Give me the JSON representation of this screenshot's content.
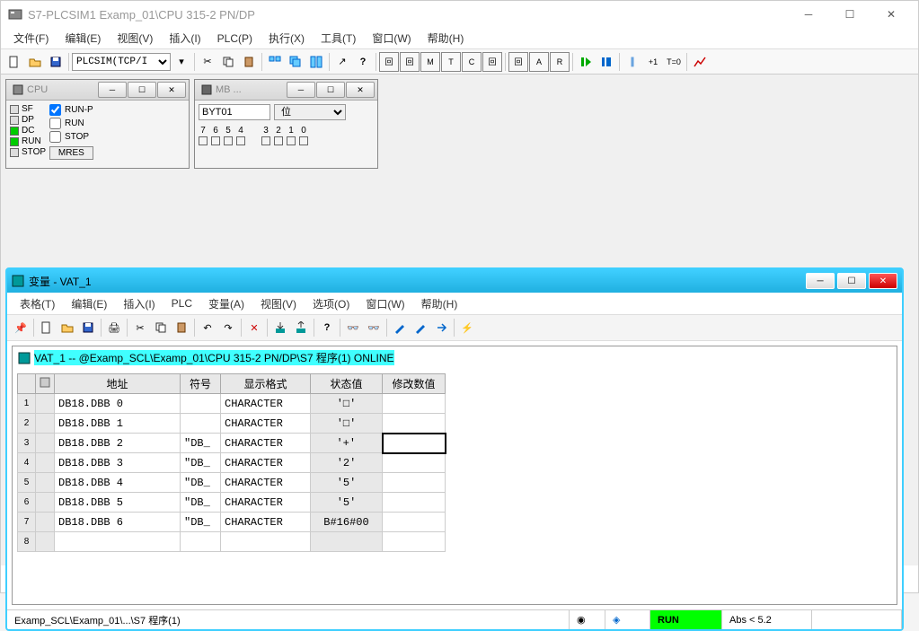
{
  "main": {
    "title": "S7-PLCSIM1    Examp_01\\CPU 315-2 PN/DP",
    "menus": [
      "文件(F)",
      "编辑(E)",
      "视图(V)",
      "插入(I)",
      "PLC(P)",
      "执行(X)",
      "工具(T)",
      "窗口(W)",
      "帮助(H)"
    ],
    "connection_select": "PLCSIM(TCP/I"
  },
  "cpu": {
    "title": "CPU",
    "leds": [
      {
        "label": "SF",
        "color": "off"
      },
      {
        "label": "DP",
        "color": "off"
      },
      {
        "label": "DC",
        "color": "green"
      },
      {
        "label": "RUN",
        "color": "green"
      },
      {
        "label": "STOP",
        "color": "off"
      }
    ],
    "modes": [
      {
        "label": "RUN-P",
        "checked": true
      },
      {
        "label": "RUN",
        "checked": false
      },
      {
        "label": "STOP",
        "checked": false
      }
    ],
    "mres": "MRES"
  },
  "mb": {
    "title": "MB ...",
    "field": "BYT01",
    "format": "位",
    "bits_high": [
      "7",
      "6",
      "5",
      "4"
    ],
    "bits_low": [
      "3",
      "2",
      "1",
      "0"
    ]
  },
  "vat": {
    "title": "变量 - VAT_1",
    "menus": [
      "表格(T)",
      "编辑(E)",
      "插入(I)",
      "PLC",
      "变量(A)",
      "视图(V)",
      "选项(O)",
      "窗口(W)",
      "帮助(H)"
    ],
    "inner_title": "VAT_1 -- @Examp_SCL\\Examp_01\\CPU 315-2 PN/DP\\S7 程序(1)  ONLINE",
    "columns": [
      "",
      "",
      "地址",
      "符号",
      "显示格式",
      "状态值",
      "修改数值"
    ],
    "rows": [
      {
        "n": "1",
        "addr": "DB18.DBB    0",
        "sym": "",
        "fmt": "CHARACTER",
        "status": "'□'",
        "mod": ""
      },
      {
        "n": "2",
        "addr": "DB18.DBB    1",
        "sym": "",
        "fmt": "CHARACTER",
        "status": "'□'",
        "mod": ""
      },
      {
        "n": "3",
        "addr": "DB18.DBB    2",
        "sym": "\"DB_",
        "fmt": "CHARACTER",
        "status": "'+'",
        "mod": "",
        "editing": true
      },
      {
        "n": "4",
        "addr": "DB18.DBB    3",
        "sym": "\"DB_",
        "fmt": "CHARACTER",
        "status": "'2'",
        "mod": ""
      },
      {
        "n": "5",
        "addr": "DB18.DBB    4",
        "sym": "\"DB_",
        "fmt": "CHARACTER",
        "status": "'5'",
        "mod": ""
      },
      {
        "n": "6",
        "addr": "DB18.DBB    5",
        "sym": "\"DB_",
        "fmt": "CHARACTER",
        "status": "'5'",
        "mod": ""
      },
      {
        "n": "7",
        "addr": "DB18.DBB    6",
        "sym": "\"DB_",
        "fmt": "CHARACTER",
        "status": "B#16#00",
        "mod": ""
      },
      {
        "n": "8",
        "addr": "",
        "sym": "",
        "fmt": "",
        "status": "",
        "mod": ""
      }
    ]
  },
  "statusbar": {
    "path": "Examp_SCL\\Examp_01\\...\\S7 程序(1)",
    "mode": "RUN",
    "abs": "Abs < 5.2"
  },
  "toolbar_extra": {
    "plus1": "+1",
    "t0": "T=0"
  }
}
